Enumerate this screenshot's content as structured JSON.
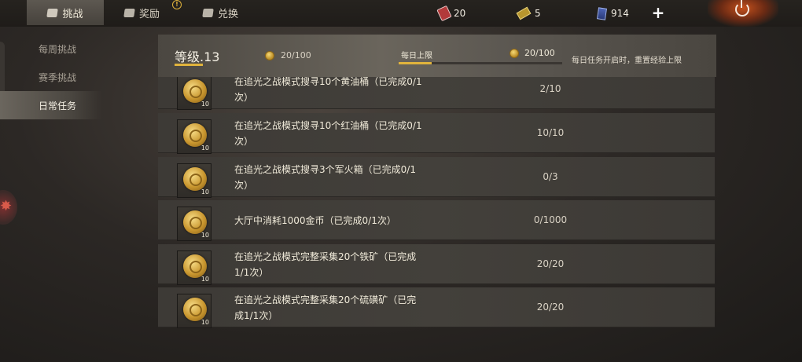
{
  "tabs": {
    "challenge": "挑战",
    "reward": "奖励",
    "exchange": "兑换",
    "reward_alert": "!"
  },
  "resources": {
    "cards": "20",
    "tickets": "5",
    "gems": "914",
    "add": "+"
  },
  "sidebar": {
    "items": [
      {
        "label": "每周挑战"
      },
      {
        "label": "赛季挑战"
      },
      {
        "label": "日常任务"
      }
    ],
    "active_index": 2
  },
  "header": {
    "level": "等级.13",
    "exp": "20/100",
    "daily_limit_label": "每日上限",
    "daily_limit_value": "20/100",
    "daily_limit_fraction": 0.2,
    "reset_note": "每日任务开启时，重置经验上限"
  },
  "tasks": [
    {
      "desc": "在追光之战模式搜寻10个黄油桶（已完成0/1次）",
      "progress": "2/10",
      "reward_count": "10"
    },
    {
      "desc": "在追光之战模式搜寻10个红油桶（已完成0/1次）",
      "progress": "10/10",
      "reward_count": "10"
    },
    {
      "desc": "在追光之战模式搜寻3个军火箱（已完成0/1次）",
      "progress": "0/3",
      "reward_count": "10"
    },
    {
      "desc": "大厅中消耗1000金币（已完成0/1次）",
      "progress": "0/1000",
      "reward_count": "10"
    },
    {
      "desc": "在追光之战模式完整采集20个铁矿（已完成1/1次）",
      "progress": "20/20",
      "reward_count": "10"
    },
    {
      "desc": "在追光之战模式完整采集20个硫磺矿（已完成1/1次）",
      "progress": "20/20",
      "reward_count": "10"
    }
  ]
}
